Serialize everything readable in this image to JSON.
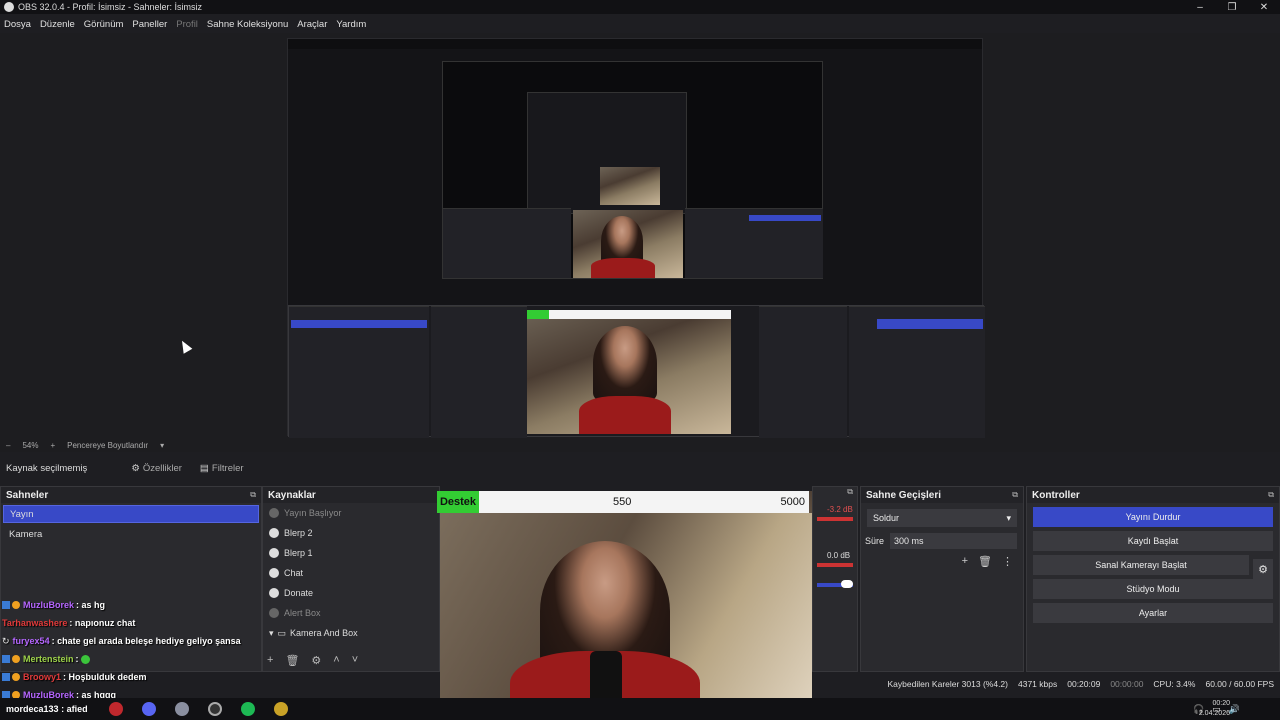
{
  "window": {
    "title": "OBS 32.0.4 - Profil: İsimsiz - Sahneler: İsimsiz"
  },
  "window_controls": {
    "minimize": "–",
    "maximize": "❐",
    "close": "✕"
  },
  "menu": [
    "Dosya",
    "Düzenle",
    "Görünüm",
    "Paneller",
    "Profil",
    "Sahne Koleksiyonu",
    "Araçlar",
    "Yardım"
  ],
  "preview": {
    "zoom_label": "54%",
    "zoom_minus": "–",
    "zoom_plus": "+",
    "fit_label": "Pencereye Boyutlandır",
    "fit_arrow": "▾"
  },
  "source_bar": {
    "no_source": "Kaynak seçilmemiş",
    "properties": "Özellikler",
    "filters": "Filtreler"
  },
  "scenes": {
    "title": "Sahneler",
    "items": [
      {
        "label": "Yayın",
        "selected": true
      },
      {
        "label": "Kamera",
        "selected": false
      }
    ]
  },
  "sources": {
    "title": "Kaynaklar",
    "items": [
      {
        "label": "Yayın Başlıyor",
        "dim": true
      },
      {
        "label": "Blerp 2",
        "dim": false
      },
      {
        "label": "Blerp 1",
        "dim": false
      },
      {
        "label": "Chat",
        "dim": false
      },
      {
        "label": "Donate",
        "dim": false
      },
      {
        "label": "Alert Box",
        "dim": true
      },
      {
        "label": "Kamera And Box",
        "dim": false
      }
    ],
    "tools": [
      "+",
      "🗑",
      "⚙",
      "˄",
      "˅"
    ]
  },
  "overlay": {
    "tag": "Destek",
    "current": "550",
    "goal": "5000"
  },
  "mixer": {
    "db1": "-3.2 dB",
    "db2": "0.0 dB"
  },
  "transitions": {
    "title": "Sahne Geçişleri",
    "selected": "Soldur",
    "duration_label": "Süre",
    "duration_value": "300 ms",
    "tools": [
      "+",
      "🗑",
      "⋮"
    ]
  },
  "controls": {
    "title": "Kontroller",
    "buttons": [
      "Yayını Durdur",
      "Kaydı Başlat",
      "Sanal Kamerayı Başlat",
      "Stüdyo Modu",
      "Ayarlar"
    ]
  },
  "chat": [
    {
      "user": "MuzluBorek",
      "sep": ":",
      "msg": "as hg",
      "color": "#b566ff"
    },
    {
      "user": "Tarhanwashere",
      "sep": ":",
      "msg": "napıonuz chat",
      "color": "#e03a3a"
    },
    {
      "user": "furyex54",
      "sep": ":",
      "msg": "chate gel arada beleşe hediye geliyo şansa",
      "color": "#b566ff"
    },
    {
      "user": "Mertenstein",
      "sep": ":",
      "msg": "",
      "color": "#9dd24a"
    },
    {
      "user": "Broowy1",
      "sep": ":",
      "msg": "Hoşbulduk dedem",
      "color": "#e03a3a"
    },
    {
      "user": "MuzluBorek",
      "sep": ":",
      "msg": "as hggg",
      "color": "#b566ff"
    },
    {
      "user": "mordeca133",
      "sep": ":",
      "msg": "afied",
      "color": "#ffffff"
    }
  ],
  "status": {
    "dropped": "Kaybedilen Kareler 3013 (%4.2)",
    "bitrate": "4371 kbps",
    "stream_time": "00:20:09",
    "rec_time": "00:00:00",
    "cpu": "CPU: 3.4%",
    "fps": "60.00 / 60.00 FPS"
  },
  "clock": {
    "time": "00:20",
    "date": "2.04.2026"
  },
  "colors": {
    "accent": "#3849c7",
    "overlay_green": "#33cc33"
  }
}
